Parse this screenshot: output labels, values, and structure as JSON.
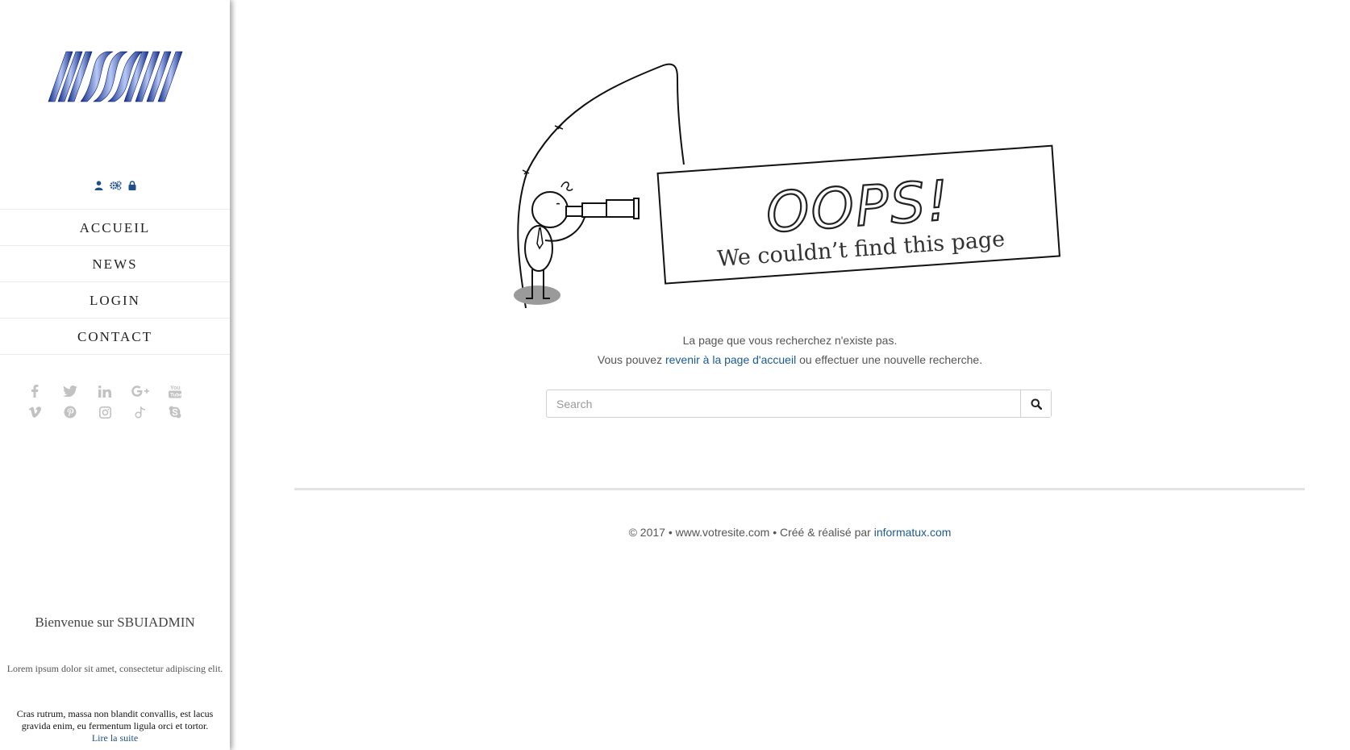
{
  "sidebar": {
    "logo_alt": "SBUIADMIN logo",
    "admin_icons": [
      "user-icon",
      "cogs-icon",
      "lock-icon"
    ],
    "nav": [
      {
        "label": "ACCUEIL"
      },
      {
        "label": "NEWS"
      },
      {
        "label": "LOGIN"
      },
      {
        "label": "CONTACT"
      }
    ],
    "social_row1": [
      "facebook-icon",
      "twitter-icon",
      "linkedin-icon",
      "google-plus-icon",
      "youtube-icon"
    ],
    "social_row2": [
      "vimeo-icon",
      "pinterest-icon",
      "instagram-icon",
      "tiktok-icon",
      "skype-icon"
    ],
    "welcome_title": "Bienvenue sur SBUIADMIN",
    "welcome_lead": "Lorem ipsum dolor sit amet, consectetur adipiscing elit.",
    "welcome_body": "Cras rutrum, massa non blandit convallis, est lacus gravida enim, eu fermentum ligula orci et tortor.",
    "read_more": "Lire la suite"
  },
  "error": {
    "oops": "OOPS!",
    "subtitle": "We couldn’t find this page",
    "message_line1": "La page que vous recherchez n'existe pas.",
    "message_line2_before": "Vous pouvez ",
    "message_line2_link": "revenir à la page d'accueil",
    "message_line2_after": " ou effectuer une nouvelle recherche."
  },
  "search": {
    "placeholder": "Search",
    "value": "",
    "button_icon": "search-icon"
  },
  "footer": {
    "text": "© 2017 • www.votresite.com • Créé & réalisé par ",
    "link": "informatux.com"
  },
  "colors": {
    "accent": "#1a5a94",
    "icon_grey": "#bdbdbd",
    "admin_icon": "#1f4f8a"
  }
}
